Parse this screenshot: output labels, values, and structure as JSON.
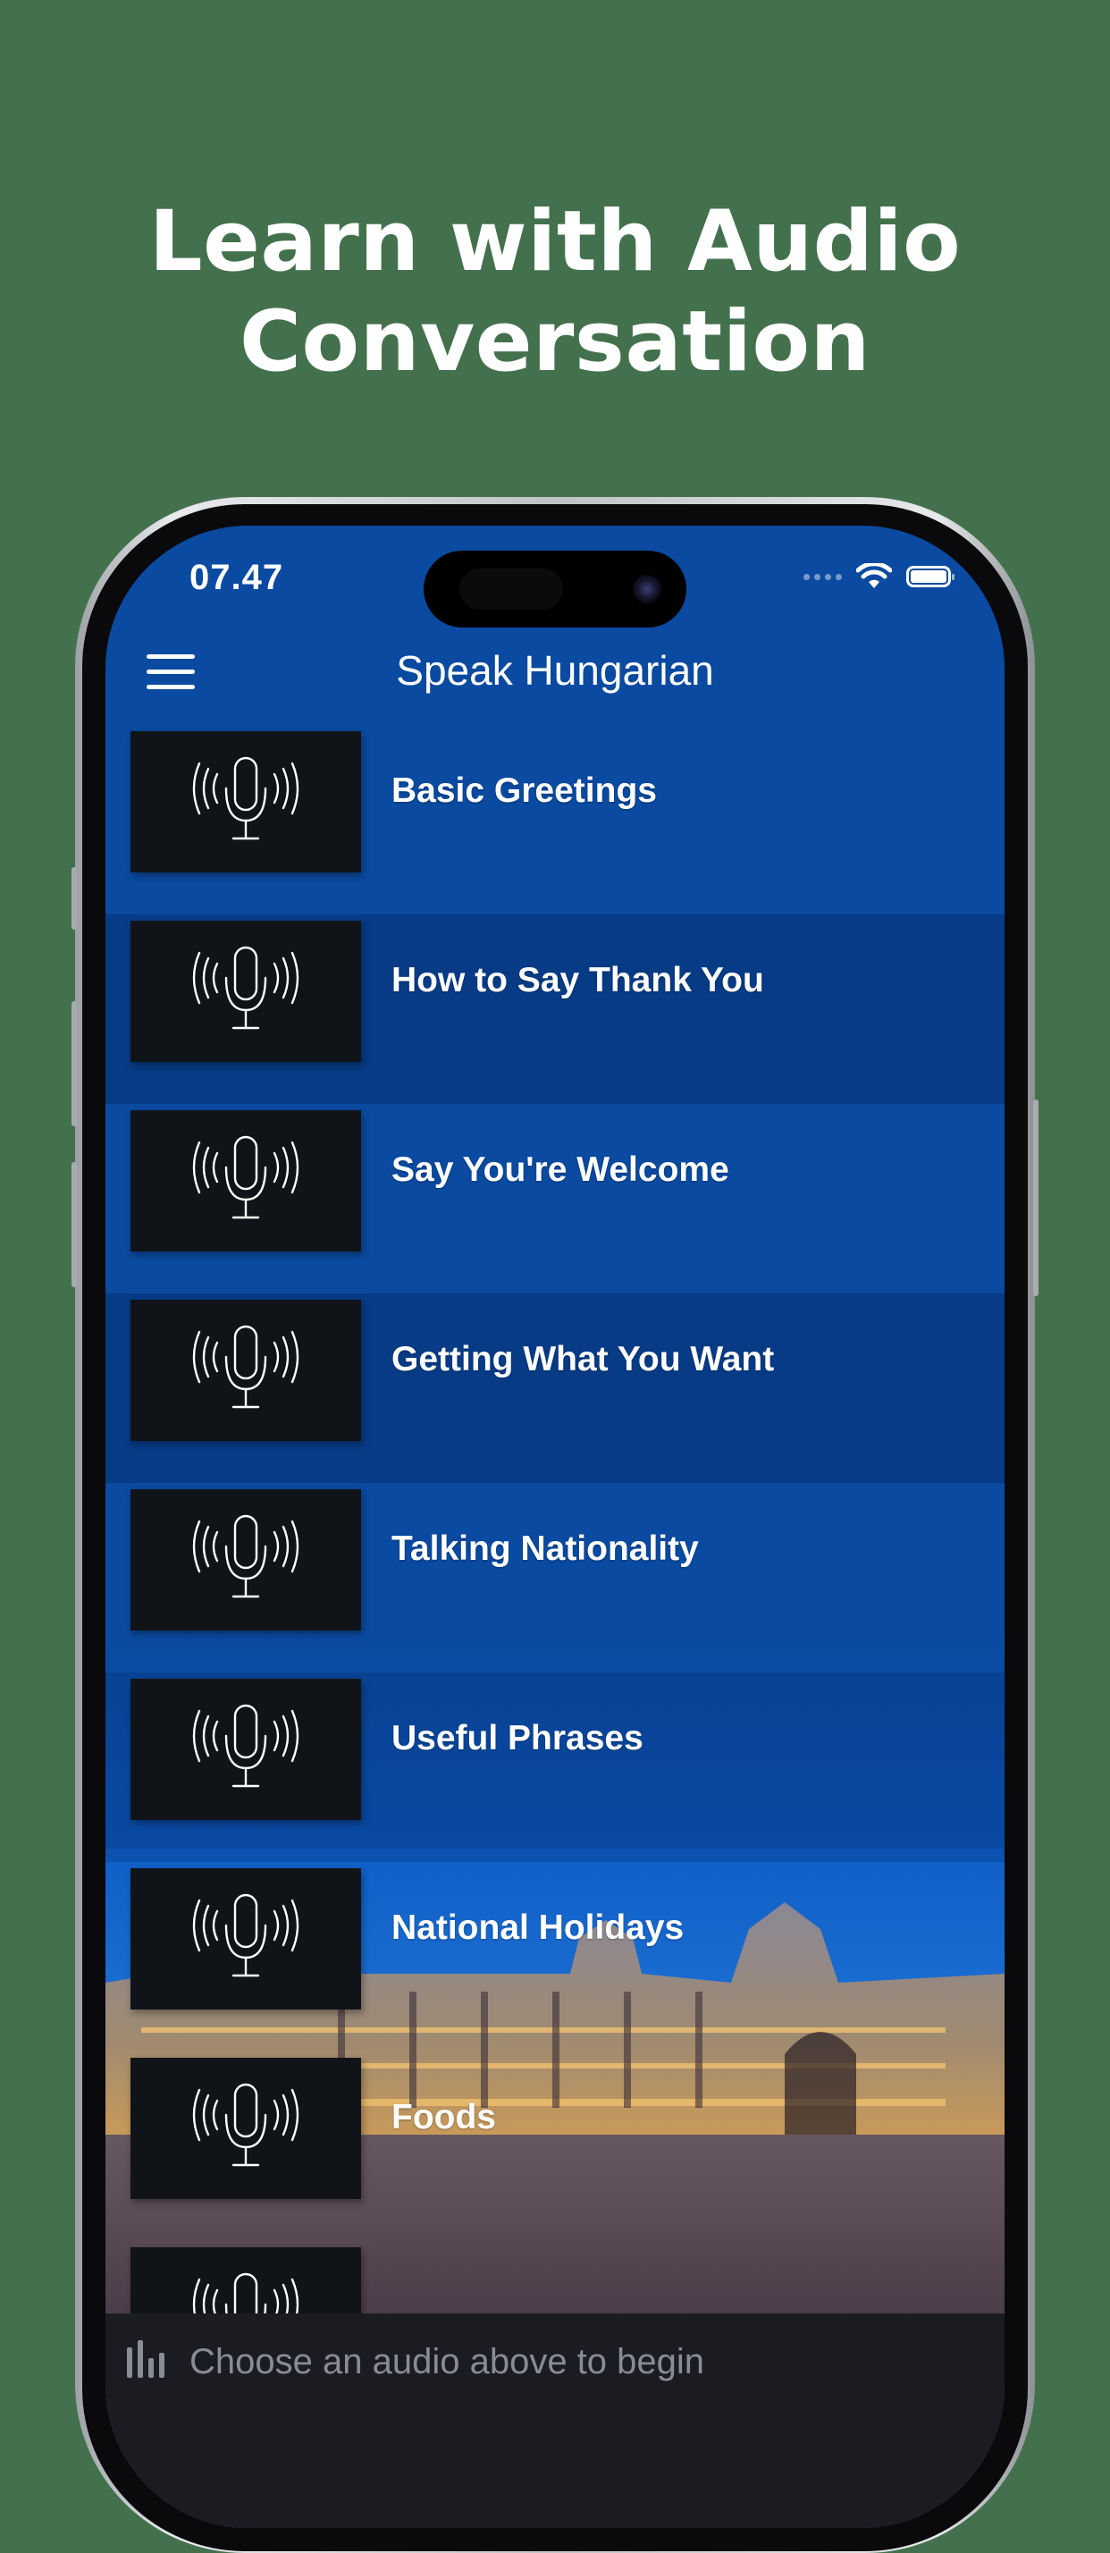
{
  "headline": {
    "line1": "Learn with Audio",
    "line2": "Conversation"
  },
  "status_bar": {
    "time": "07.47"
  },
  "nav": {
    "title": "Speak Hungarian",
    "menu_icon": "hamburger-menu-icon"
  },
  "lessons": [
    {
      "label": "Basic Greetings",
      "icon": "microphone-icon"
    },
    {
      "label": "How to Say Thank You",
      "icon": "microphone-icon"
    },
    {
      "label": "Say You're Welcome",
      "icon": "microphone-icon"
    },
    {
      "label": "Getting What You Want",
      "icon": "microphone-icon"
    },
    {
      "label": "Talking Nationality",
      "icon": "microphone-icon"
    },
    {
      "label": "Useful Phrases",
      "icon": "microphone-icon"
    },
    {
      "label": "National Holidays",
      "icon": "microphone-icon"
    },
    {
      "label": "Foods",
      "icon": "microphone-icon"
    }
  ],
  "player": {
    "status_text": "Choose an audio above to begin",
    "icon": "audio-bars-icon"
  },
  "colors": {
    "background": "#44714d",
    "screen_blue": "#0a4aa0",
    "thumb": "#101418",
    "player_bar": "#1b1c22"
  }
}
